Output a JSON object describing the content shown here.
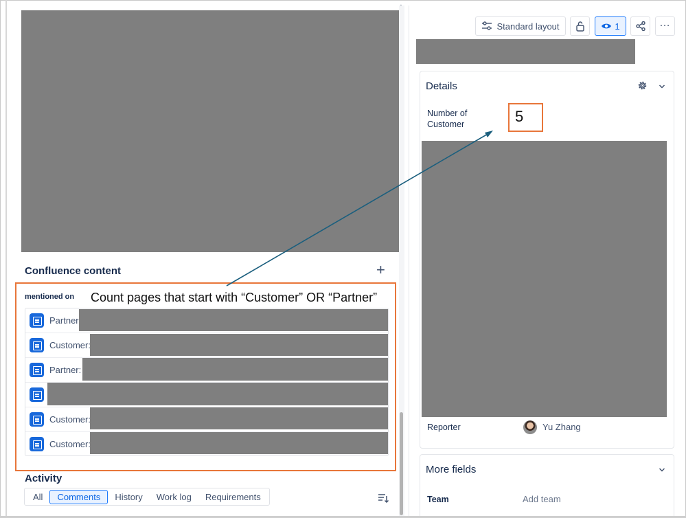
{
  "header": {
    "layout_button_label": "Standard layout",
    "watch_count": "1"
  },
  "confluence": {
    "title": "Confluence content",
    "mentioned_label": "mentioned on",
    "pages": [
      {
        "label": "Partner"
      },
      {
        "label": "Customer:"
      },
      {
        "label": "Partner:"
      },
      {
        "label": ""
      },
      {
        "label": "Customer:"
      },
      {
        "label": "Customer:"
      }
    ]
  },
  "annotation": {
    "instruction": "Count pages that start with “Customer” OR “Partner”",
    "accent_color": "#e8763a",
    "arrow_color": "#1b5f7e"
  },
  "activity": {
    "title": "Activity",
    "tabs": [
      {
        "label": "All"
      },
      {
        "label": "Comments",
        "active": true
      },
      {
        "label": "History"
      },
      {
        "label": "Work log"
      },
      {
        "label": "Requirements"
      }
    ]
  },
  "details": {
    "title": "Details",
    "number_of_customer_label": "Number of Customer",
    "number_of_customer_value": "5",
    "reporter_label": "Reporter",
    "reporter_name": "Yu Zhang"
  },
  "more_fields": {
    "title": "More fields",
    "team_label": "Team",
    "team_placeholder": "Add team"
  },
  "colors": {
    "redaction": "#7f7f7f",
    "page_icon": "#1868db",
    "selected_tab": "#0c66e4"
  }
}
